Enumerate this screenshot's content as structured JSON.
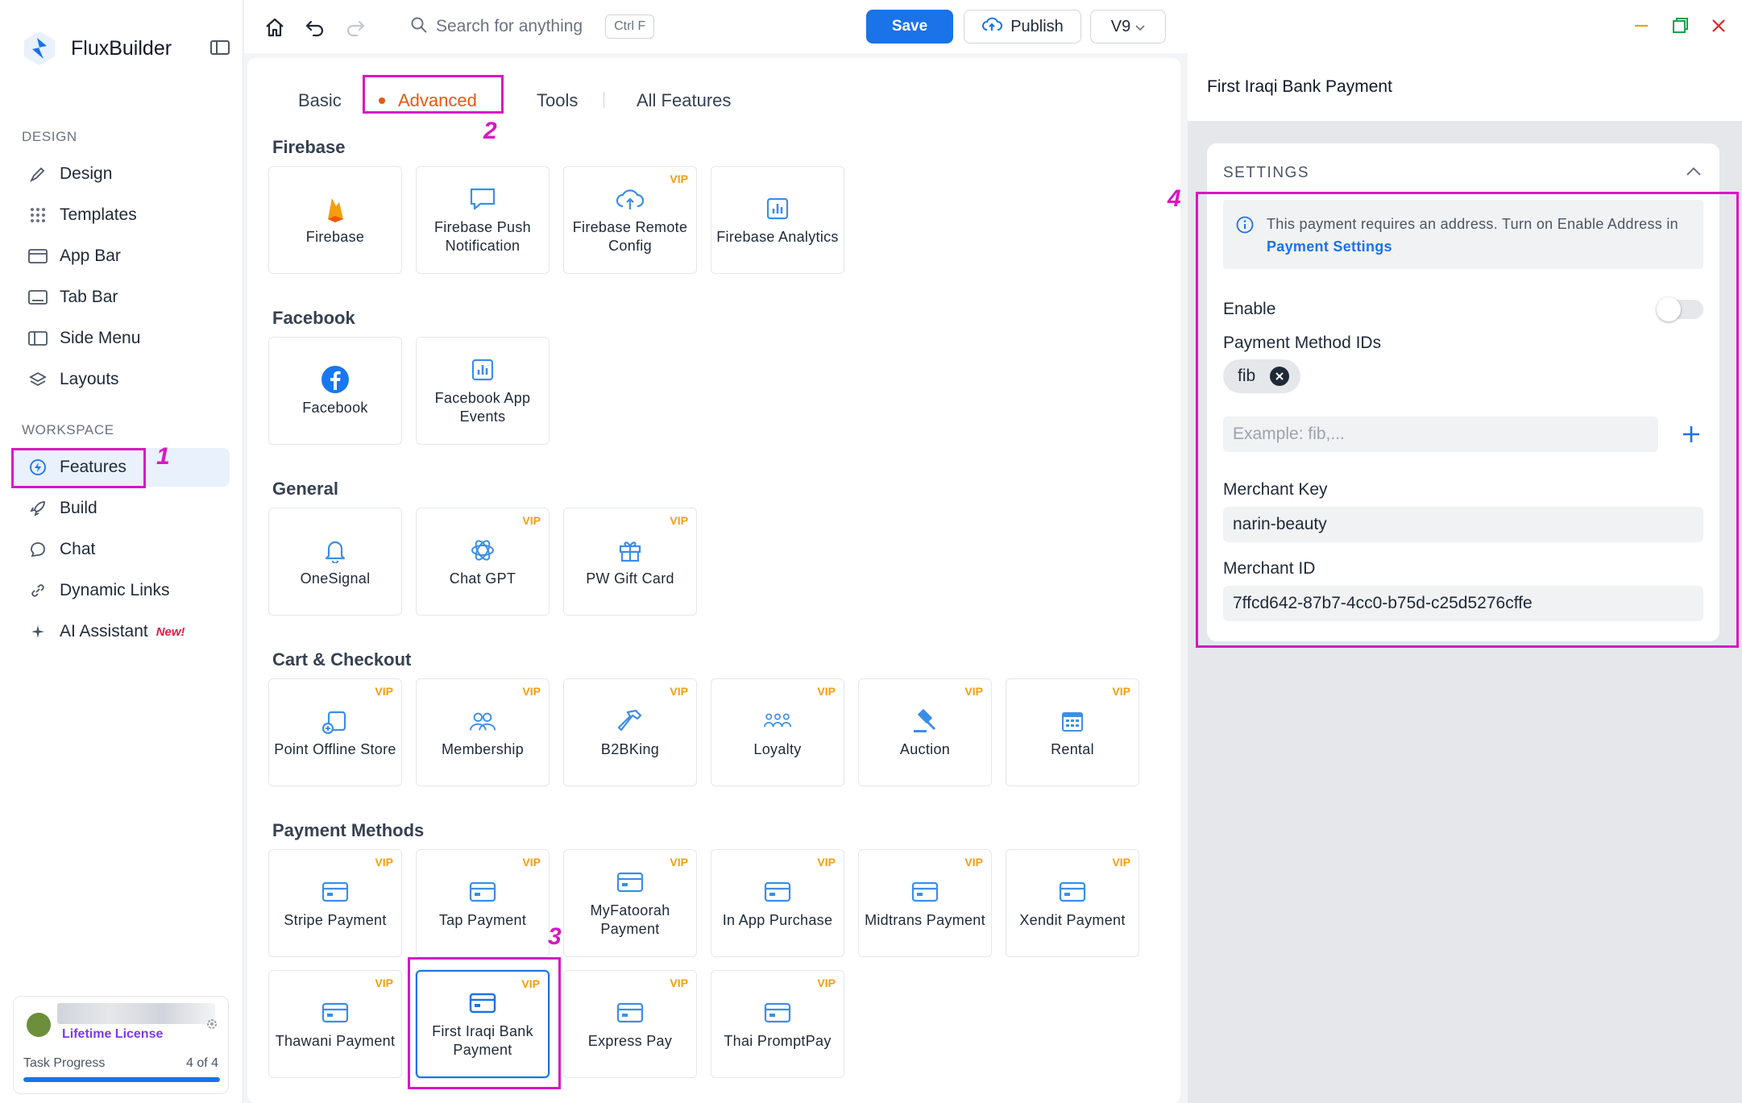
{
  "app": {
    "name": "FluxBuilder"
  },
  "sidebar": {
    "design_label": "DESIGN",
    "workspace_label": "WORKSPACE",
    "design_items": [
      {
        "label": "Design",
        "icon": "brush-icon"
      },
      {
        "label": "Templates",
        "icon": "grid-icon"
      },
      {
        "label": "App Bar",
        "icon": "app-bar-icon"
      },
      {
        "label": "Tab Bar",
        "icon": "tab-bar-icon"
      },
      {
        "label": "Side Menu",
        "icon": "side-menu-icon"
      },
      {
        "label": "Layouts",
        "icon": "layers-icon"
      }
    ],
    "workspace_items": [
      {
        "label": "Features",
        "icon": "bolt-icon",
        "active": true
      },
      {
        "label": "Build",
        "icon": "rocket-icon"
      },
      {
        "label": "Chat",
        "icon": "chat-icon"
      },
      {
        "label": "Dynamic Links",
        "icon": "link-icon"
      },
      {
        "label": "AI Assistant",
        "icon": "sparkle-icon",
        "badge": "New!"
      }
    ],
    "license": {
      "plan": "Lifetime License",
      "task_label": "Task Progress",
      "task_count": "4 of 4",
      "task_progress": 1.0
    }
  },
  "topbar": {
    "search_placeholder": "Search for anything",
    "search_shortcut": "Ctrl F",
    "save_label": "Save",
    "publish_label": "Publish",
    "version_label": "V9"
  },
  "features": {
    "tabs": [
      {
        "label": "Basic",
        "active": false
      },
      {
        "label": "Advanced",
        "active": true
      },
      {
        "label": "Tools",
        "active": false
      },
      {
        "label": "All Features",
        "active": false
      }
    ],
    "vip_label": "VIP",
    "groups": [
      {
        "title": "Firebase",
        "items": [
          {
            "label": "Firebase",
            "icon": "firebase-flame-icon",
            "vip": false
          },
          {
            "label": "Firebase Push Notification",
            "icon": "message-icon",
            "vip": false
          },
          {
            "label": "Firebase Remote Config",
            "icon": "cloud-upload-icon",
            "vip": true
          },
          {
            "label": "Firebase Analytics",
            "icon": "bar-chart-icon",
            "vip": false
          }
        ]
      },
      {
        "title": "Facebook",
        "items": [
          {
            "label": "Facebook",
            "icon": "facebook-icon",
            "vip": false
          },
          {
            "label": "Facebook App Events",
            "icon": "bar-chart-icon",
            "vip": false
          }
        ]
      },
      {
        "title": "General",
        "items": [
          {
            "label": "OneSignal",
            "icon": "bell-icon",
            "vip": false
          },
          {
            "label": "Chat GPT",
            "icon": "openai-icon",
            "vip": true
          },
          {
            "label": "PW Gift Card",
            "icon": "gift-icon",
            "vip": true
          }
        ]
      },
      {
        "title": "Cart & Checkout",
        "items": [
          {
            "label": "Point Offline Store",
            "icon": "store-icon",
            "vip": true
          },
          {
            "label": "Membership",
            "icon": "users-icon",
            "vip": true
          },
          {
            "label": "B2BKing",
            "icon": "hammer-icon",
            "vip": true
          },
          {
            "label": "Loyalty",
            "icon": "group-icon",
            "vip": true
          },
          {
            "label": "Auction",
            "icon": "gavel-icon",
            "vip": true
          },
          {
            "label": "Rental",
            "icon": "calendar-icon",
            "vip": true
          }
        ]
      },
      {
        "title": "Payment Methods",
        "items": [
          {
            "label": "Stripe Payment",
            "icon": "card-icon",
            "vip": true
          },
          {
            "label": "Tap Payment",
            "icon": "card-icon",
            "vip": true
          },
          {
            "label": "MyFatoorah Payment",
            "icon": "card-icon",
            "vip": true
          },
          {
            "label": "In App Purchase",
            "icon": "card-icon",
            "vip": true
          },
          {
            "label": "Midtrans Payment",
            "icon": "card-icon",
            "vip": true
          },
          {
            "label": "Xendit Payment",
            "icon": "card-icon",
            "vip": true
          },
          {
            "label": "Thawani Payment",
            "icon": "card-icon",
            "vip": true
          },
          {
            "label": "First Iraqi Bank Payment",
            "icon": "card-icon",
            "vip": true,
            "selected": true
          },
          {
            "label": "Express Pay",
            "icon": "card-icon",
            "vip": true
          },
          {
            "label": "Thai PromptPay",
            "icon": "card-icon",
            "vip": true
          }
        ]
      }
    ]
  },
  "panel": {
    "title": "First Iraqi Bank Payment",
    "settings_label": "SETTINGS",
    "info_text": "This payment requires an address. Turn on Enable Address in ",
    "info_link": "Payment Settings",
    "enable_label": "Enable",
    "enable_on": false,
    "method_ids_label": "Payment Method IDs",
    "method_ids": [
      "fib"
    ],
    "method_id_placeholder": "Example: fib,...",
    "merchant_key_label": "Merchant Key",
    "merchant_key_value": "narin-beauty",
    "merchant_id_label": "Merchant ID",
    "merchant_id_value": "7ffcd642-87b7-4cc0-b75d-c25d5276cffe"
  },
  "annotations": [
    "1",
    "2",
    "3",
    "4"
  ],
  "colors": {
    "accent": "#1a73e8",
    "tab_active": "#ea580c",
    "vip": "#f59e0b",
    "annotation": "#d916c4",
    "new_badge": "#e11d48"
  }
}
